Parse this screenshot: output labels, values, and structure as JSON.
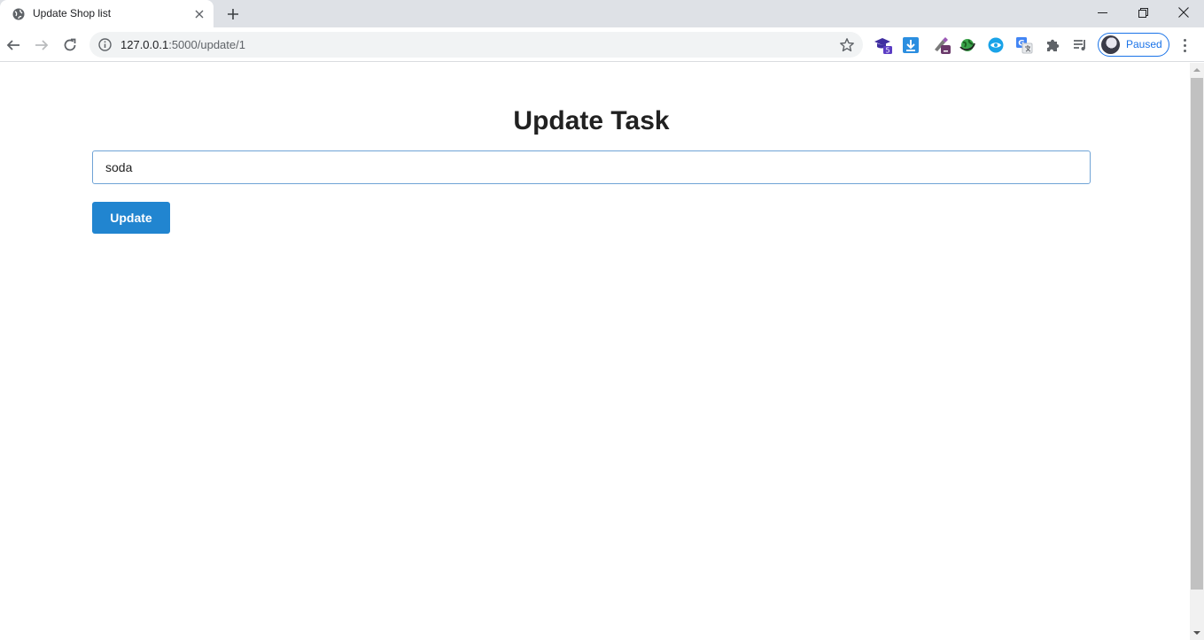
{
  "browser": {
    "tab": {
      "title": "Update Shop list",
      "favicon": "globe-icon"
    },
    "address": {
      "host": "127.0.0.1",
      "rest": ":5000/update/1"
    },
    "profile_label": "Paused",
    "badges": {
      "ext1": "5"
    }
  },
  "page": {
    "heading": "Update Task",
    "task_input_value": "soda",
    "update_button_label": "Update"
  },
  "colors": {
    "button": "#2185d0",
    "input_border": "#6fa3d6",
    "profile_accent": "#1a73e8"
  }
}
